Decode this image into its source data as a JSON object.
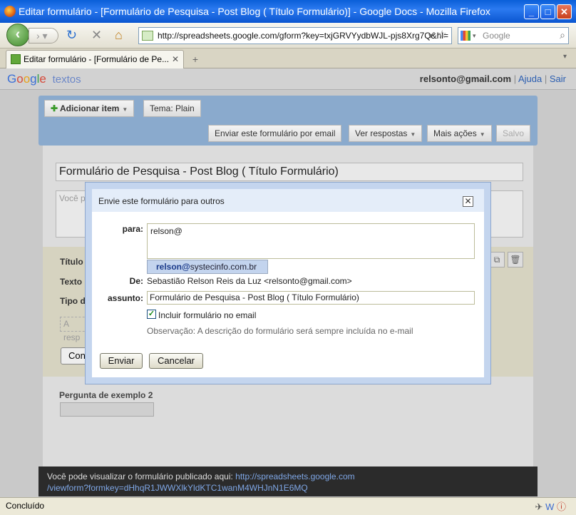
{
  "window": {
    "title": "Editar formulário - [Formulário de Pesquisa - Post Blog ( Título Formulário)] - Google Docs - Mozilla Firefox",
    "minimize": "_",
    "maximize": "□",
    "close": "✕"
  },
  "nav": {
    "url": "http://spreadsheets.google.com/gform?key=txjGRVYydbWJL-pjs8Xrg7Q&hl=",
    "search_placeholder": "Google"
  },
  "tab": {
    "label": "Editar formulário - [Formulário de Pe..."
  },
  "header": {
    "logo": [
      "G",
      "o",
      "o",
      "g",
      "l",
      "e"
    ],
    "product": "textos",
    "email": "relsonto@gmail.com",
    "help": "Ajuda",
    "logout": "Sair",
    "sep": "|"
  },
  "toolbar": {
    "add_item": "Adicionar item",
    "theme": "Tema:  Plain",
    "send_email": "Enviar este formulário por email",
    "view_responses": "Ver respostas",
    "more_actions": "Mais ações",
    "save": "Salvo"
  },
  "form": {
    "title": "Formulário de Pesquisa - Post Blog ( Título Formulário)",
    "desc_partial": "Você p",
    "q_title_label": "Título d",
    "q_help_label": "Texto d",
    "q_type_label": "Tipo de",
    "q_answer_partial": "A resp",
    "q_done_partial": "Con",
    "q2_label": "Pergunta de exemplo 2"
  },
  "infobar": {
    "text": "Você pode visualizar o formulário publicado aqui: ",
    "link1": "http://spreadsheets.google.com",
    "link2": "/viewform?formkey=dHhqR1JWWXlkYldKTC1wanM4WHJnN1E6MQ"
  },
  "status": {
    "text": "Concluído"
  },
  "dialog": {
    "title": "Envie este formulário para outros",
    "close": "✕",
    "to_label": "para:",
    "to_value": "relson@",
    "suggest_bold": "relson@",
    "suggest_rest": "systecinfo.com.br",
    "from_label": "De:",
    "from_value": "Sebastião Relson Reis da Luz <relsonto@gmail.com>",
    "subject_label": "assunto:",
    "subject_value": "Formulário de Pesquisa - Post Blog ( Título Formulário)",
    "include_label": "Incluir formulário no email",
    "include_checked": true,
    "note": "Observação: A descrição do formulário será sempre incluída no e-mail",
    "send": "Enviar",
    "cancel": "Cancelar"
  }
}
